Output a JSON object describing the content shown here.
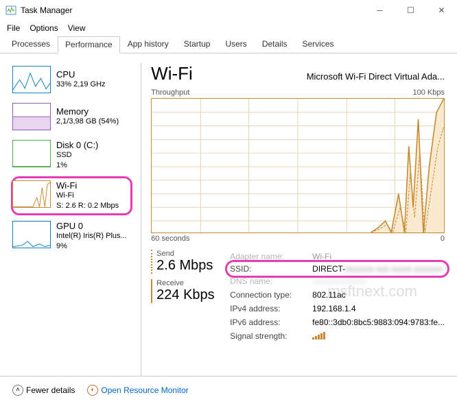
{
  "window": {
    "title": "Task Manager"
  },
  "menu": [
    "File",
    "Options",
    "View"
  ],
  "tabs": [
    "Processes",
    "Performance",
    "App history",
    "Startup",
    "Users",
    "Details",
    "Services"
  ],
  "active_tab": "Performance",
  "sidebar": {
    "items": [
      {
        "title": "CPU",
        "sub1": "33% 2,19 GHz"
      },
      {
        "title": "Memory",
        "sub1": "2,1/3,98 GB (54%)"
      },
      {
        "title": "Disk 0 (C:)",
        "sub1": "SSD",
        "sub2": "1%"
      },
      {
        "title": "Wi-Fi",
        "sub1": "Wi-Fi",
        "sub2": "S: 2.6 R: 0.2 Mbps"
      },
      {
        "title": "GPU 0",
        "sub1": "Intel(R) Iris(R) Plus...",
        "sub2": "9%"
      }
    ]
  },
  "detail": {
    "title": "Wi-Fi",
    "subtitle": "Microsoft Wi-Fi Direct Virtual Ada...",
    "chart_label": "Throughput",
    "chart_max": "100 Kbps",
    "chart_time_left": "60 seconds",
    "chart_time_right": "0",
    "send_label": "Send",
    "send_val": "2.6 Mbps",
    "recv_label": "Receive",
    "recv_val": "224 Kbps",
    "props": {
      "adapter_name_l": "Adapter name:",
      "adapter_name_v": "Wi-Fi",
      "ssid_l": "SSID:",
      "ssid_v": "DIRECT-",
      "dns_l": "DNS name:",
      "dns_v": "",
      "conn_l": "Connection type:",
      "conn_v": "802.11ac",
      "ipv4_l": "IPv4 address:",
      "ipv4_v": "192.168.1.4",
      "ipv6_l": "IPv6 address:",
      "ipv6_v": "fe80::3db0:8bc5:9883:094:9783:fe...",
      "sig_l": "Signal strength:"
    }
  },
  "footer": {
    "fewer": "Fewer details",
    "monitor": "Open Resource Monitor"
  },
  "watermark": "msftnext.com",
  "chart_data": {
    "type": "line",
    "title": "Throughput",
    "xlabel": "60 seconds",
    "ylabel": "",
    "ylim": [
      0,
      100
    ],
    "yunit": "Kbps",
    "x_seconds_ago": [
      60,
      55,
      50,
      45,
      40,
      35,
      30,
      25,
      20,
      15,
      12,
      10,
      9,
      8,
      7,
      6,
      5,
      4,
      3,
      2,
      1,
      0
    ],
    "series": [
      {
        "name": "Send",
        "values": [
          0,
          0,
          0,
          0,
          0,
          0,
          0,
          0,
          0,
          0,
          5,
          10,
          5,
          2,
          8,
          30,
          60,
          20,
          5,
          90,
          30,
          100
        ]
      },
      {
        "name": "Receive",
        "values": [
          0,
          0,
          0,
          0,
          0,
          0,
          0,
          0,
          0,
          0,
          2,
          4,
          2,
          1,
          3,
          18,
          40,
          10,
          3,
          55,
          20,
          70
        ]
      }
    ]
  }
}
